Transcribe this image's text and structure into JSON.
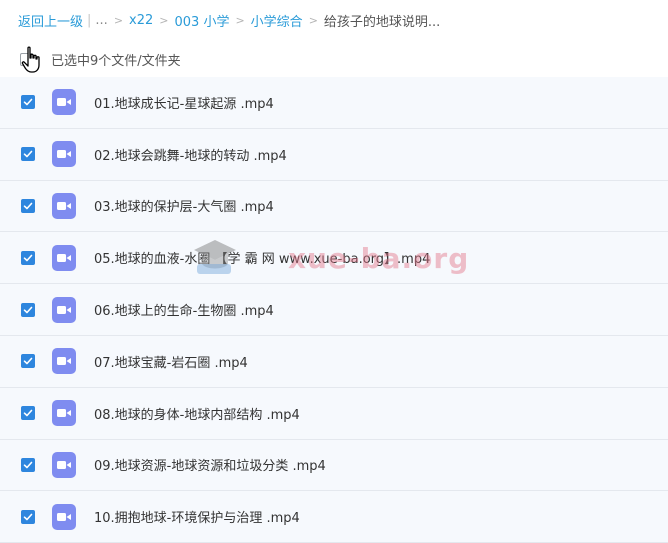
{
  "breadcrumb": {
    "back_label": "返回上一级",
    "ellipsis": "...",
    "items": [
      "x22",
      "003 小学",
      "小学综合"
    ],
    "current": "给孩子的地球说明..."
  },
  "selection": {
    "status_text": "已选中9个文件/文件夹"
  },
  "files": [
    {
      "name": "01.地球成长记-星球起源 .mp4",
      "checked": true
    },
    {
      "name": "02.地球会跳舞-地球的转动 .mp4",
      "checked": true
    },
    {
      "name": "03.地球的保护层-大气圈 .mp4",
      "checked": true
    },
    {
      "name": "05.地球的血液-水圈 【学 霸 网 www.xue-ba.org】.mp4",
      "checked": true
    },
    {
      "name": "06.地球上的生命-生物圈 .mp4",
      "checked": true
    },
    {
      "name": "07.地球宝藏-岩石圈 .mp4",
      "checked": true
    },
    {
      "name": "08.地球的身体-地球内部结构 .mp4",
      "checked": true
    },
    {
      "name": "09.地球资源-地球资源和垃圾分类 .mp4",
      "checked": true
    },
    {
      "name": "10.拥抱地球-环境保护与治理 .mp4",
      "checked": true
    }
  ],
  "watermark": {
    "text": "xue-ba.org"
  },
  "colors": {
    "accent": "#2a9bd8",
    "checkbox": "#2e86de",
    "video_icon": "#7f8cf0"
  }
}
